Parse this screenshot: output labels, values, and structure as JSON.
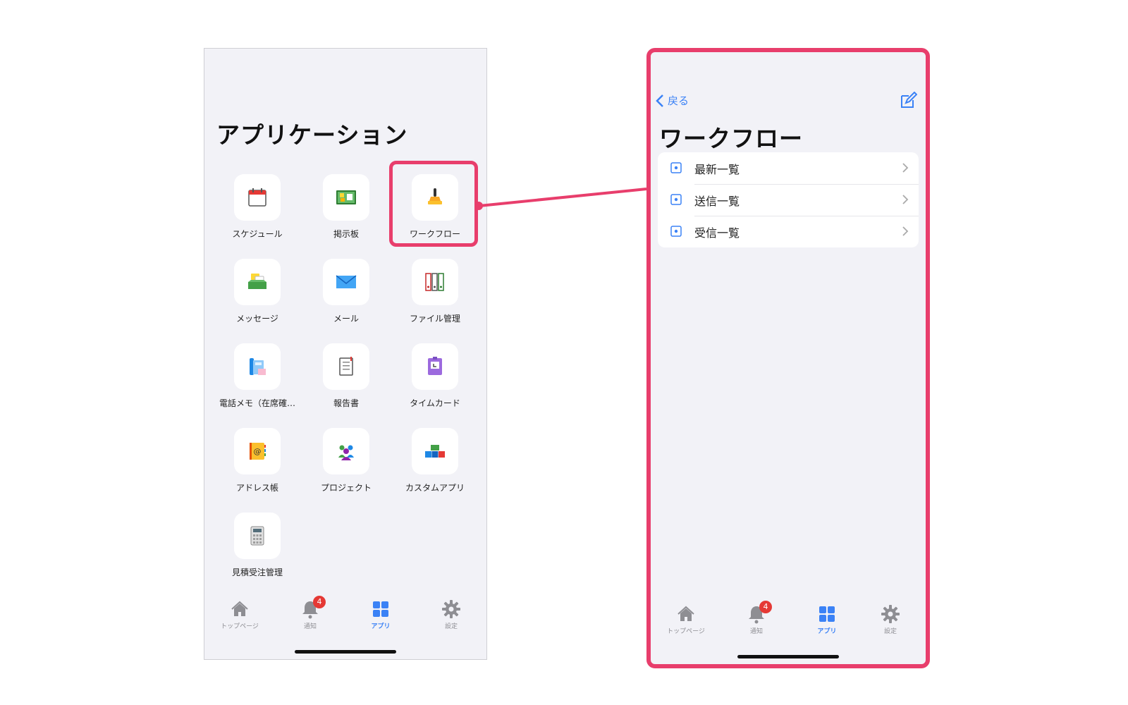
{
  "left_screen": {
    "title": "アプリケーション",
    "apps": [
      {
        "label": "スケジュール",
        "icon": "calendar-icon"
      },
      {
        "label": "掲示板",
        "icon": "bulletin-board-icon"
      },
      {
        "label": "ワークフロー",
        "icon": "stamp-icon"
      },
      {
        "label": "メッセージ",
        "icon": "message-tray-icon"
      },
      {
        "label": "メール",
        "icon": "mail-icon"
      },
      {
        "label": "ファイル管理",
        "icon": "binders-icon"
      },
      {
        "label": "電話メモ（在席確…",
        "icon": "phone-memo-icon"
      },
      {
        "label": "報告書",
        "icon": "report-icon"
      },
      {
        "label": "タイムカード",
        "icon": "timecard-icon"
      },
      {
        "label": "アドレス帳",
        "icon": "address-book-icon"
      },
      {
        "label": "プロジェクト",
        "icon": "project-people-icon"
      },
      {
        "label": "カスタムアプリ",
        "icon": "blocks-icon"
      },
      {
        "label": "見積受注管理",
        "icon": "calculator-icon"
      }
    ]
  },
  "tabbar": {
    "tabs": [
      {
        "label": "トップページ",
        "icon": "home-icon"
      },
      {
        "label": "通知",
        "icon": "bell-icon",
        "badge": "4"
      },
      {
        "label": "アプリ",
        "icon": "apps-grid-icon",
        "active": true
      },
      {
        "label": "設定",
        "icon": "gear-icon"
      }
    ]
  },
  "right_screen": {
    "back_label": "戻る",
    "title": "ワークフロー",
    "items": [
      {
        "label": "最新一覧"
      },
      {
        "label": "送信一覧"
      },
      {
        "label": "受信一覧"
      }
    ]
  },
  "colors": {
    "highlight": "#e83e6c",
    "accent": "#3b82f6",
    "background": "#f2f2f7",
    "badge": "#e53935"
  }
}
